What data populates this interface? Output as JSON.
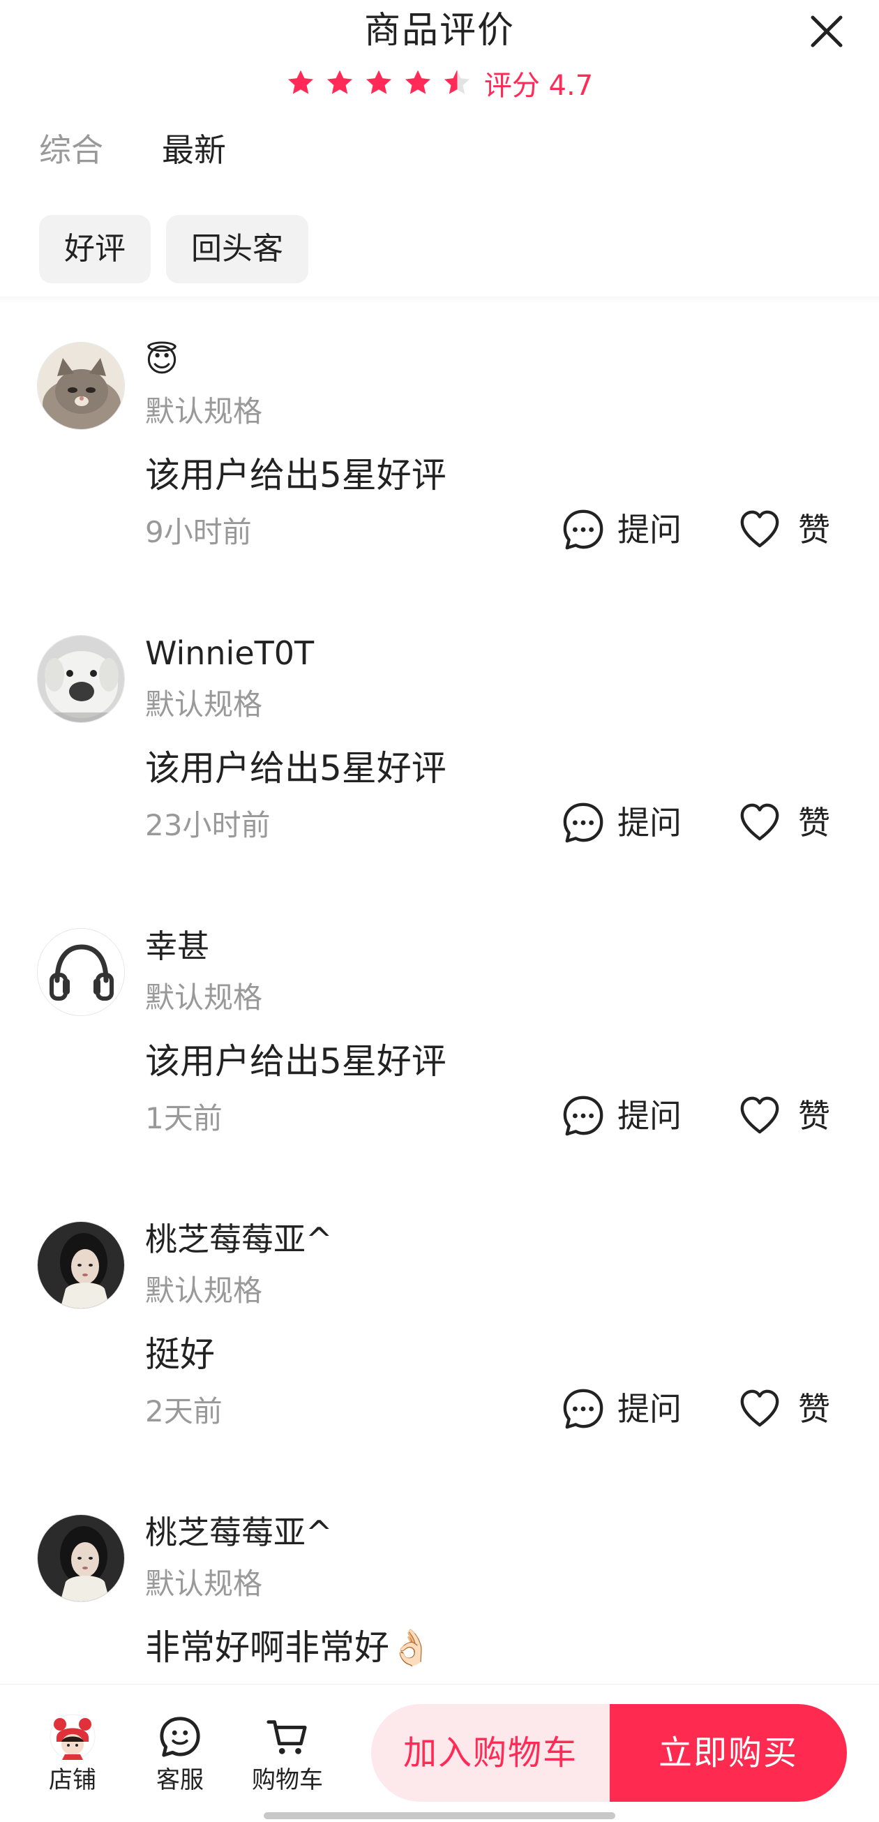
{
  "header": {
    "title": "商品评价",
    "rating_text": "评分 4.7",
    "rating_value": 4.7,
    "stars_max": 5,
    "close_icon": "close-icon"
  },
  "tabs": [
    {
      "label": "综合",
      "active": false
    },
    {
      "label": "最新",
      "active": true
    }
  ],
  "filters": [
    {
      "label": "好评"
    },
    {
      "label": "回头客"
    }
  ],
  "reviews": [
    {
      "username": "😇",
      "spec": "默认规格",
      "content": "该用户给出5星好评",
      "time": "9小时前",
      "ask_label": "提问",
      "like_label": "赞",
      "avatar": "kitten-avatar"
    },
    {
      "username": "WinnieT0T",
      "spec": "默认规格",
      "content": "该用户给出5星好评",
      "time": "23小时前",
      "ask_label": "提问",
      "like_label": "赞",
      "avatar": "white-dog-avatar"
    },
    {
      "username": "幸甚",
      "spec": "默认规格",
      "content": "该用户给出5星好评",
      "time": "1天前",
      "ask_label": "提问",
      "like_label": "赞",
      "avatar": "headphones-avatar"
    },
    {
      "username": "桃芝莓莓亚^",
      "spec": "默认规格",
      "content": "挺好",
      "time": "2天前",
      "ask_label": "提问",
      "like_label": "赞",
      "avatar": "woman-portrait-avatar"
    },
    {
      "username": "桃芝莓莓亚^",
      "spec": "默认规格",
      "content": "非常好啊非常好👌🏻",
      "avatar": "woman-portrait-avatar"
    }
  ],
  "bottom_bar": {
    "store_label": "店铺",
    "service_label": "客服",
    "cart_label": "购物车",
    "add_to_cart_label": "加入购物车",
    "buy_now_label": "立即购买"
  },
  "colors": {
    "accent": "#ff2a55",
    "buy_button": "#ff2a4f",
    "cart_button_bg": "#fde9ec",
    "muted_text": "#999999"
  }
}
